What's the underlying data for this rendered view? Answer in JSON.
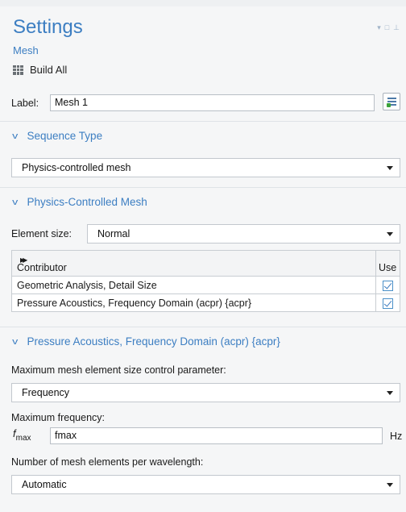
{
  "header": {
    "title": "Settings",
    "subtitle": "Mesh",
    "build_all": "Build All",
    "window_controls": [
      "▾",
      "□",
      "⊥"
    ]
  },
  "label_field": {
    "label": "Label:",
    "value": "Mesh 1"
  },
  "sequence_type": {
    "heading": "Sequence Type",
    "selected": "Physics-controlled mesh"
  },
  "physics_controlled_mesh": {
    "heading": "Physics-Controlled Mesh",
    "element_size_label": "Element size:",
    "element_size_value": "Normal",
    "table": {
      "col_contributor": "Contributor",
      "col_use": "Use",
      "rows": [
        {
          "contributor": "Geometric Analysis, Detail Size",
          "use": true
        },
        {
          "contributor": "Pressure Acoustics, Frequency Domain (acpr) {acpr}",
          "use": true
        }
      ]
    }
  },
  "acpr_section": {
    "heading": "Pressure Acoustics, Frequency Domain (acpr) {acpr}",
    "control_param_label": "Maximum mesh element size control parameter:",
    "control_param_value": "Frequency",
    "max_freq_label": "Maximum frequency:",
    "max_freq_symbol": "f",
    "max_freq_symbol_sub": "max",
    "max_freq_value": "fmax",
    "max_freq_unit": "Hz",
    "elements_per_wavelength_label": "Number of mesh elements per wavelength:",
    "elements_per_wavelength_value": "Automatic"
  },
  "colors": {
    "accent": "#3c7ec2",
    "panel_bg": "#f5f6f7",
    "checkbox": "#3a7bbf"
  }
}
